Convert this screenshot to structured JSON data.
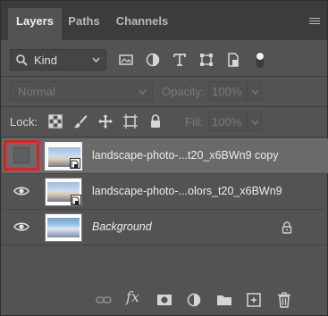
{
  "tabs": [
    {
      "label": "Layers",
      "active": true
    },
    {
      "label": "Paths",
      "active": false
    },
    {
      "label": "Channels",
      "active": false
    }
  ],
  "filter": {
    "kind_label": "Kind",
    "icons": [
      "image-filter-icon",
      "adjustment-filter-icon",
      "type-filter-icon",
      "shape-filter-icon",
      "smart-object-filter-icon",
      "filter-toggle-icon"
    ]
  },
  "blend": {
    "mode": "Normal",
    "opacity_label": "Opacity:",
    "opacity_value": "100%"
  },
  "lock": {
    "label": "Lock:",
    "fill_label": "Fill:",
    "fill_value": "100%",
    "icons": [
      "lock-transparent-pixels-icon",
      "lock-image-pixels-icon",
      "lock-position-icon",
      "lock-artboard-icon",
      "lock-all-icon"
    ]
  },
  "layers": [
    {
      "name": "landscape-photo-...t20_x6BWn9 copy",
      "visible": false,
      "selected": true,
      "italic": false,
      "locked": false
    },
    {
      "name": "landscape-photo-...olors_t20_x6BWn9",
      "visible": true,
      "selected": false,
      "italic": false,
      "locked": false
    },
    {
      "name": "Background",
      "visible": true,
      "selected": false,
      "italic": true,
      "locked": true
    }
  ],
  "bottom_icons": [
    "link-layers-icon",
    "fx-icon",
    "layer-mask-icon",
    "adjustment-layer-icon",
    "group-folder-icon",
    "new-layer-icon",
    "trash-icon"
  ],
  "colors": {
    "panel_bg": "#535353",
    "tab_bar_bg": "#3c3c3c",
    "selected_row": "#6a6a6a",
    "highlight": "#e02020"
  }
}
